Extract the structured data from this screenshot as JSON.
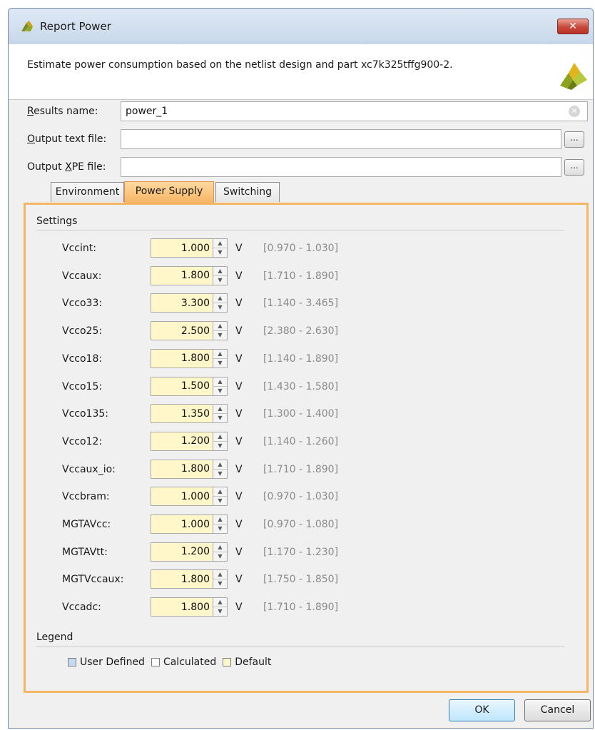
{
  "window": {
    "title": "Report Power",
    "close_label": "✕",
    "description": "Estimate power consumption based on the netlist design and part xc7k325tffg900-2."
  },
  "form": {
    "results_name_label": "Results name:",
    "results_name_value": "power_1",
    "output_text_label": "Output text file:",
    "output_text_value": "",
    "output_xpe_label": "Output XPE file:",
    "output_xpe_value": "",
    "browse_label": "..."
  },
  "tabs": [
    {
      "label": "Environment",
      "active": false
    },
    {
      "label": "Power Supply",
      "active": true
    },
    {
      "label": "Switching",
      "active": false
    }
  ],
  "settings": {
    "title": "Settings",
    "unit": "V",
    "rows": [
      {
        "label": "Vccint:",
        "value": "1.000",
        "range": "[0.970 - 1.030]"
      },
      {
        "label": "Vccaux:",
        "value": "1.800",
        "range": "[1.710 - 1.890]"
      },
      {
        "label": "Vcco33:",
        "value": "3.300",
        "range": "[1.140 - 3.465]"
      },
      {
        "label": "Vcco25:",
        "value": "2.500",
        "range": "[2.380 - 2.630]"
      },
      {
        "label": "Vcco18:",
        "value": "1.800",
        "range": "[1.140 - 1.890]"
      },
      {
        "label": "Vcco15:",
        "value": "1.500",
        "range": "[1.430 - 1.580]"
      },
      {
        "label": "Vcco135:",
        "value": "1.350",
        "range": "[1.300 - 1.400]"
      },
      {
        "label": "Vcco12:",
        "value": "1.200",
        "range": "[1.140 - 1.260]"
      },
      {
        "label": "Vccaux_io:",
        "value": "1.800",
        "range": "[1.710 - 1.890]"
      },
      {
        "label": "Vccbram:",
        "value": "1.000",
        "range": "[0.970 - 1.030]"
      },
      {
        "label": "MGTAVcc:",
        "value": "1.000",
        "range": "[0.970 - 1.080]"
      },
      {
        "label": "MGTAVtt:",
        "value": "1.200",
        "range": "[1.170 - 1.230]"
      },
      {
        "label": "MGTVccaux:",
        "value": "1.800",
        "range": "[1.750 - 1.850]"
      },
      {
        "label": "Vccadc:",
        "value": "1.800",
        "range": "[1.710 - 1.890]"
      }
    ]
  },
  "legend": {
    "title": "Legend",
    "items": [
      {
        "label": "User Defined",
        "color": "#c5d9f1"
      },
      {
        "label": "Calculated",
        "color": "#ffffff"
      },
      {
        "label": "Default",
        "color": "#fff7c9"
      }
    ]
  },
  "buttons": {
    "ok": "OK",
    "cancel": "Cancel"
  },
  "colors": {
    "active_tab": "#f7b565",
    "content_border": "#f4b565",
    "default_field": "#fff7c9"
  }
}
